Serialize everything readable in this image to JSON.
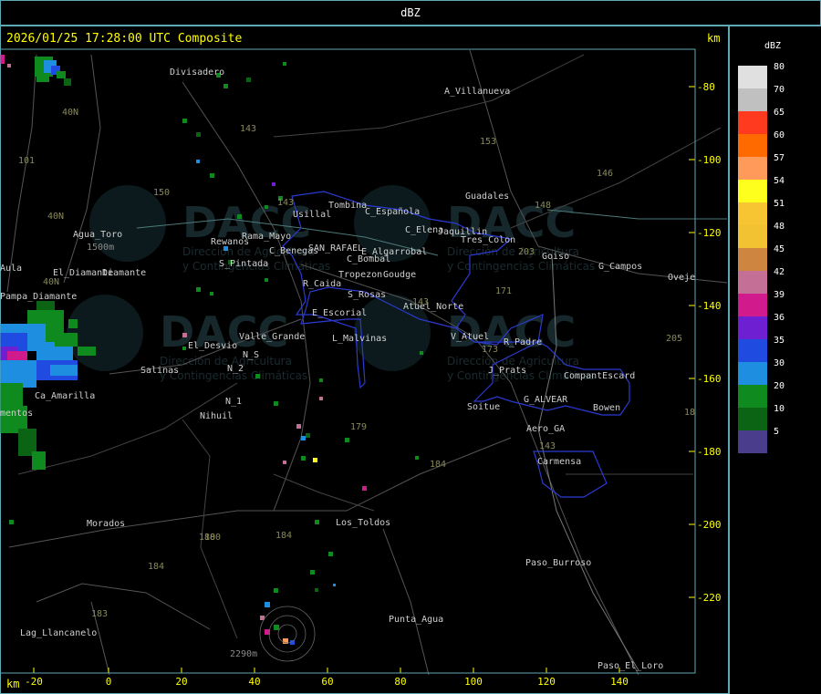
{
  "header": {
    "title": "dBZ"
  },
  "map": {
    "timestamp": "2026/01/25 17:28:00 UTC Composite",
    "unit_top": "km",
    "unit_bottom": "km",
    "x_ticks": [
      "-20",
      "0",
      "20",
      "40",
      "60",
      "80",
      "100",
      "120",
      "140"
    ],
    "y_ticks": [
      "-80",
      "-100",
      "-120",
      "-140",
      "-160",
      "-180",
      "-200",
      "-220"
    ],
    "watermark_lines": [
      "DACC",
      "Dirección de Agricultura",
      "y Contingencias Climáticas"
    ],
    "places": [
      "Divisadero",
      "A_Villanueva",
      "Guadales",
      "Usillal",
      "Tombina",
      "C_Española",
      "C_Elena",
      "Jaquillin",
      "Tres_Colon",
      "Agua_Toro",
      "Rewanos",
      "Rama_Mayo",
      "C_Benegas",
      "SAN_RAFAEL",
      "E_Algarrobal",
      "C_Bombal",
      "Goiso",
      "G_Campos",
      "Aula",
      "Pampa_Diamante",
      "S_Pintada",
      "R_Caida",
      "Tropezon",
      "Goudge",
      "S_Rosas",
      "Atuel_Norte",
      "E_Escorial",
      "Valle_Grande",
      "El_Desvio",
      "L_Malvinas",
      "V_Atuel",
      "R_Padre",
      "Salinas",
      "N_S",
      "N_2",
      "J_Prats",
      "CompantEscard",
      "Ca_Amarilla",
      "N_1",
      "Nihuil",
      "G_ALVEAR",
      "Bowen",
      "Soitue",
      "Aero_GA",
      "Carmensa",
      "Morados",
      "Los_Toldos",
      "Paso_Burroso",
      "Punta_Agua",
      "Lag_Llancanelo",
      "Paso_El_Loro",
      "Oveje",
      "mentos",
      "Diamante",
      "El_Diamante"
    ],
    "routes": [
      "40N",
      "101",
      "40N",
      "40N",
      "143",
      "150",
      "143",
      "153",
      "146",
      "148",
      "203",
      "171",
      "143",
      "184",
      "173",
      "180",
      "184",
      "179",
      "180",
      "184",
      "183",
      "143",
      "205",
      "18"
    ],
    "elevations": [
      "1500m",
      "2290m"
    ]
  },
  "legend": {
    "title": "dBZ",
    "items": [
      {
        "label": "80",
        "color": "#e0e0e0"
      },
      {
        "label": "70",
        "color": "#c0c0c0"
      },
      {
        "label": "65",
        "color": "#ff3a1e"
      },
      {
        "label": "60",
        "color": "#ff6a00"
      },
      {
        "label": "57",
        "color": "#ff9a5a"
      },
      {
        "label": "54",
        "color": "#ffff1e"
      },
      {
        "label": "51",
        "color": "#f7c531"
      },
      {
        "label": "48",
        "color": "#f3c233"
      },
      {
        "label": "45",
        "color": "#cd853f"
      },
      {
        "label": "42",
        "color": "#c46f96"
      },
      {
        "label": "39",
        "color": "#d11a8c"
      },
      {
        "label": "36",
        "color": "#6e1fd1"
      },
      {
        "label": "35",
        "color": "#1f4be0"
      },
      {
        "label": "30",
        "color": "#1e8ee0"
      },
      {
        "label": "20",
        "color": "#0e8a1e"
      },
      {
        "label": "10",
        "color": "#0a6414"
      },
      {
        "label": "5",
        "color": "#4a3e8c"
      }
    ]
  }
}
